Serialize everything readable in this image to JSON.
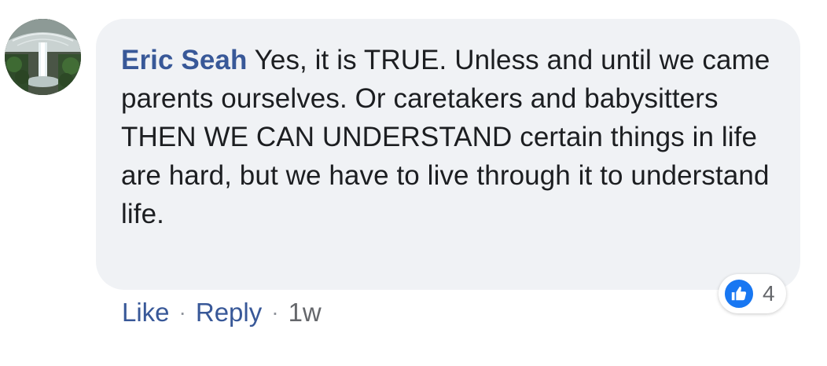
{
  "comment": {
    "author": "Eric Seah",
    "text": "Yes, it is TRUE. Unless and until we came parents ourselves. Or caretakers and babysitters THEN WE CAN UNDERSTAND certain things in life are hard, but we have to live through it to understand life."
  },
  "reactions": {
    "icon": "thumbs-up-icon",
    "count": "4"
  },
  "actions": {
    "like_label": "Like",
    "reply_label": "Reply",
    "separator": "·",
    "timestamp": "1w"
  },
  "colors": {
    "author_link": "#385898",
    "bubble_bg": "#f0f2f5",
    "like_blue": "#1877f2",
    "meta_gray": "#65676b"
  }
}
